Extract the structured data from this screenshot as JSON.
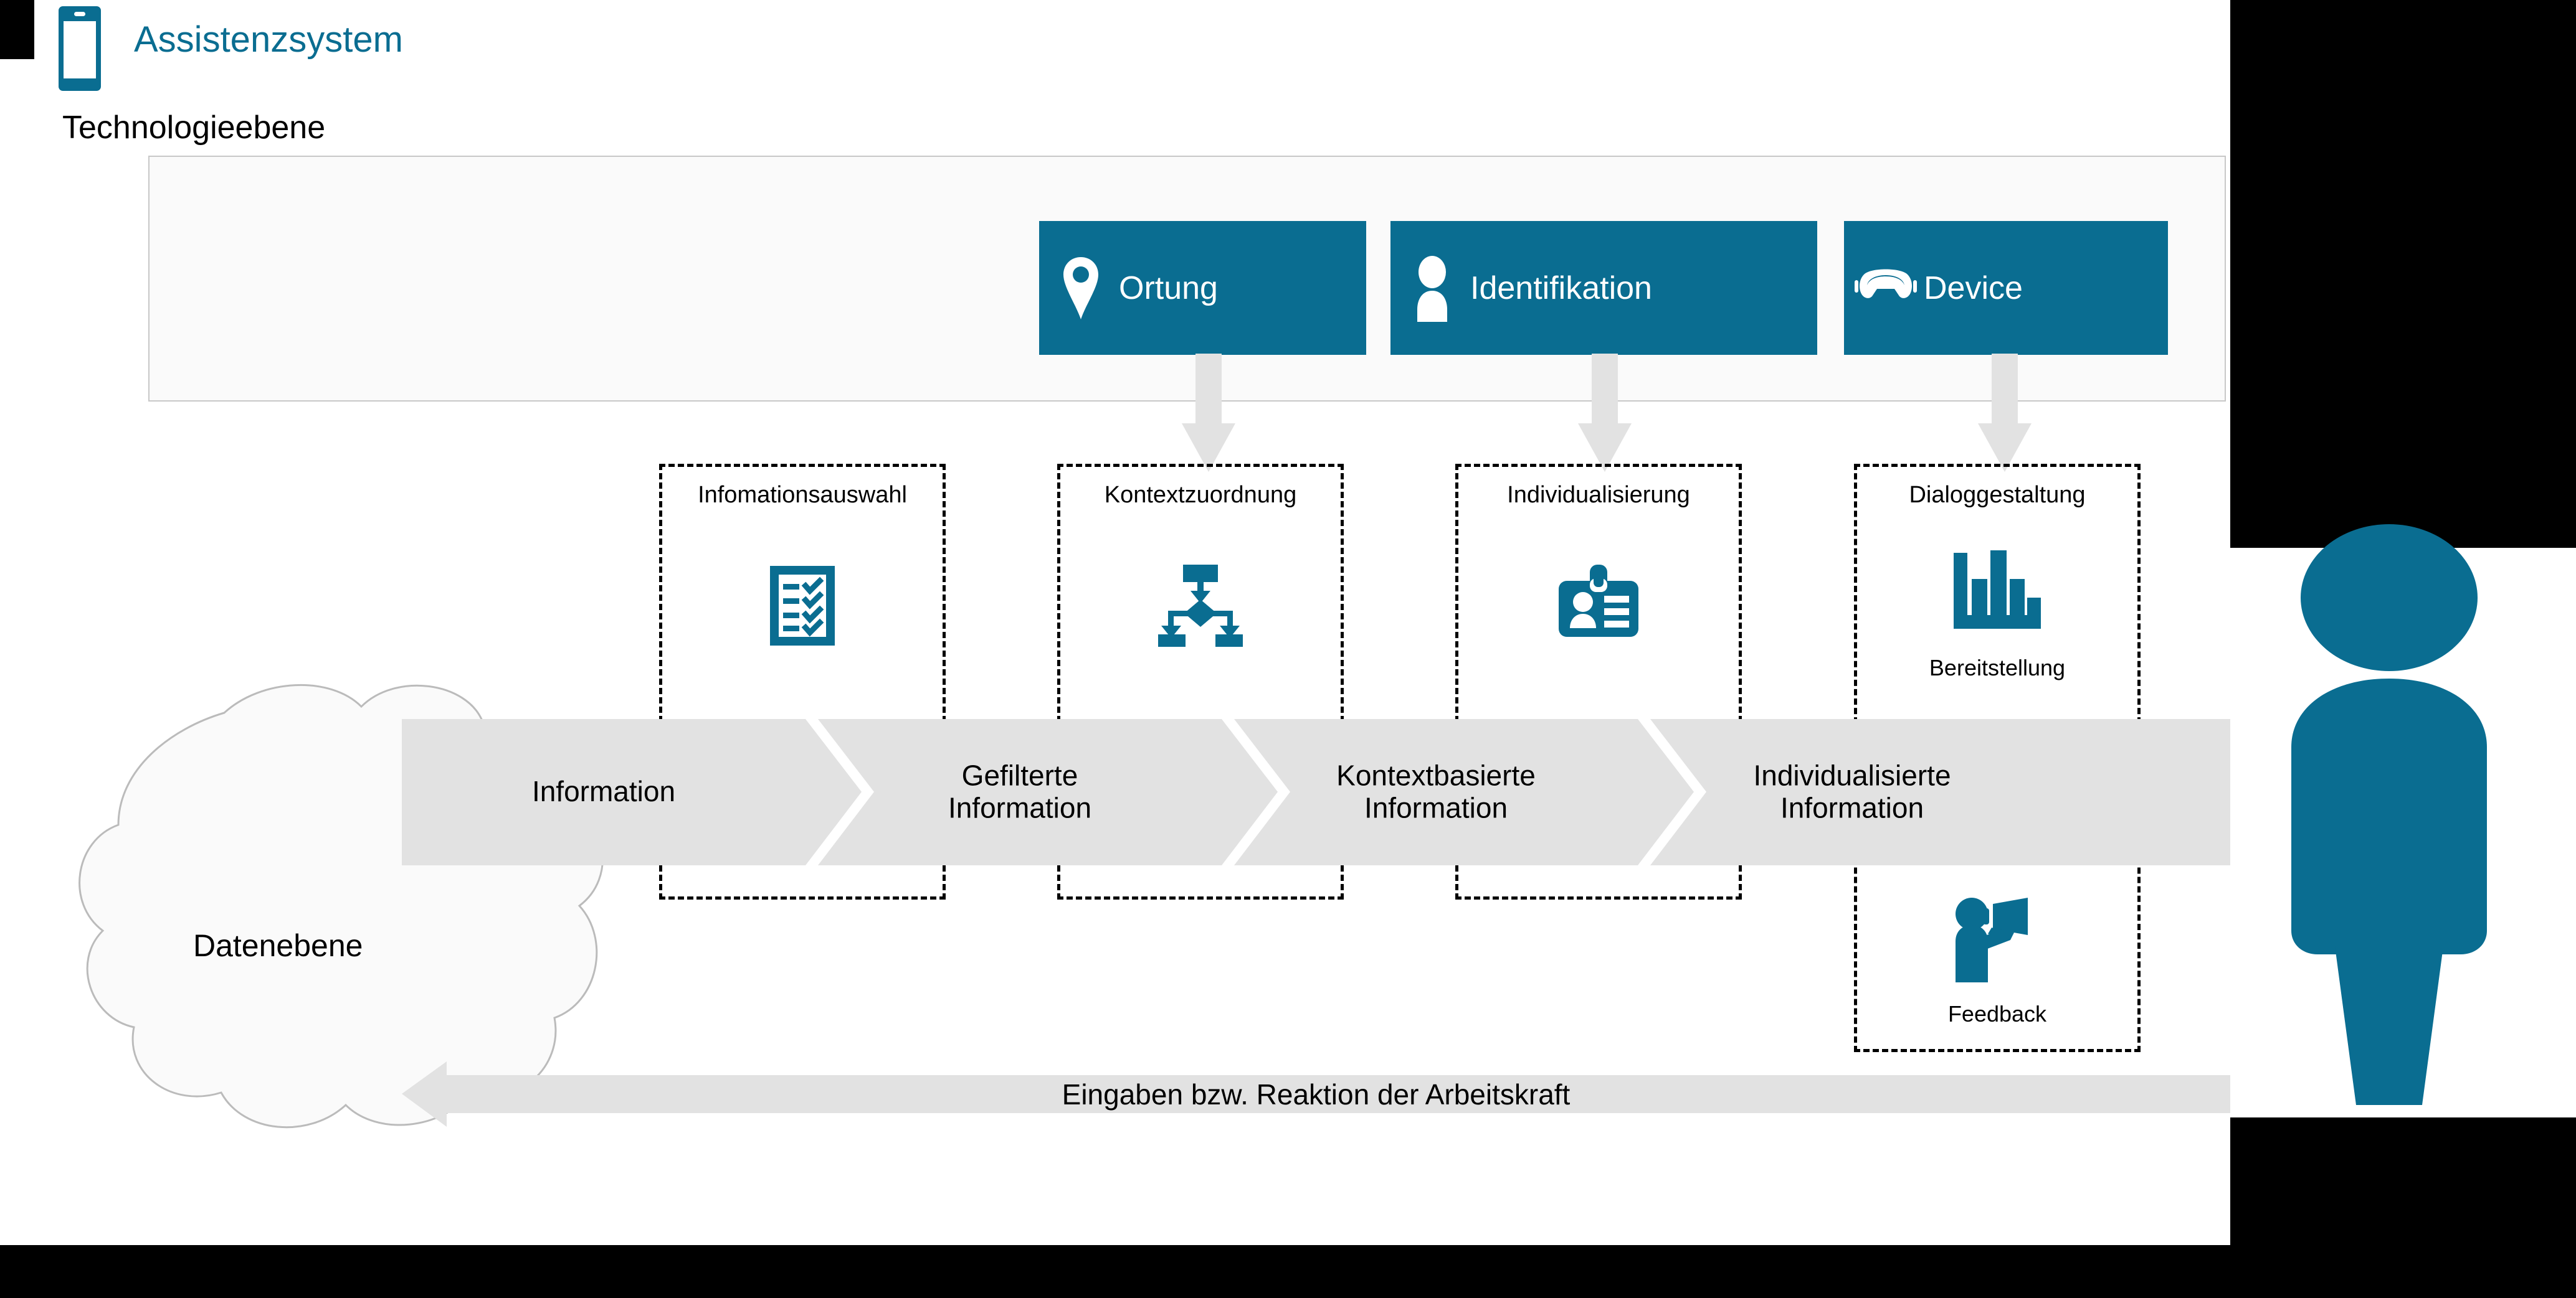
{
  "header": {
    "title": "Assistenzsystem",
    "phone_icon": "smartphone-icon"
  },
  "technology_layer": {
    "label": "Technologieebene",
    "items": [
      {
        "label": "Ortung",
        "icon": "location-pin-icon"
      },
      {
        "label": "Identifikation",
        "icon": "person-icon"
      },
      {
        "label": "Device",
        "icon": "ar-glasses-icon"
      }
    ]
  },
  "stages": [
    {
      "label": "Infomationsauswahl",
      "icon": "checklist-icon"
    },
    {
      "label": "Kontextzuordnung",
      "icon": "flowchart-icon"
    },
    {
      "label": "Individualisierung",
      "icon": "id-badge-icon"
    },
    {
      "label": "Dialoggestaltung",
      "icon": "bar-chart-icon",
      "sub_items": [
        {
          "label": "Bereitstellung",
          "icon": "bar-chart-icon"
        },
        {
          "label": "Feedback",
          "icon": "megaphone-person-icon"
        }
      ]
    }
  ],
  "data_layer": {
    "label": "Datenebene",
    "icon": "cloud-shape"
  },
  "flow": {
    "steps": [
      "Information",
      "Gefilterte\nInformation",
      "Kontextbasierte\nInformation",
      "Individualisierte\nInformation"
    ],
    "step_1": "Information",
    "step_2_line1": "Gefilterte",
    "step_2_line2": "Information",
    "step_3_line1": "Kontextbasierte",
    "step_3_line2": "Information",
    "step_4_line1": "Individualisierte",
    "step_4_line2": "Information"
  },
  "feedback_arrow": {
    "label": "Eingaben bzw. Reaktion der Arbeitskraft",
    "direction": "left"
  },
  "worker": {
    "icon": "worker-person-icon"
  },
  "colors": {
    "brand_blue": "#0a6d91",
    "band_gray": "#e2e2e2",
    "panel_bg": "#fafafa",
    "panel_border": "#c8c8c8",
    "canvas": "#ffffff",
    "backdrop": "#000000"
  }
}
